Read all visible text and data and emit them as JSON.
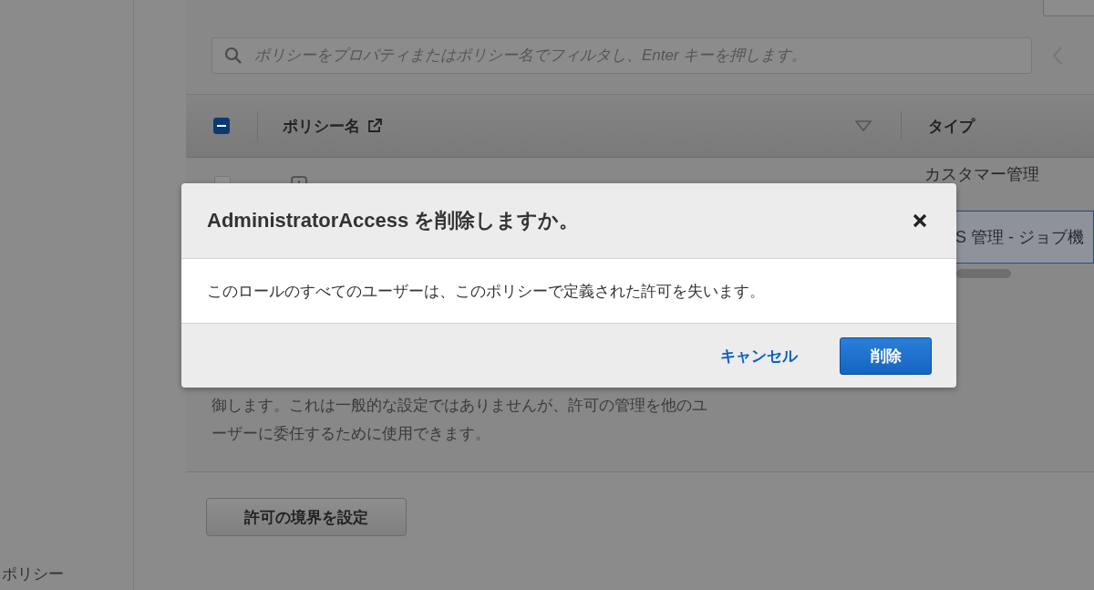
{
  "sidebar": {
    "items": [
      {
        "label": "ポリシー"
      }
    ]
  },
  "filter": {
    "placeholder": "ポリシーをプロパティまたはポリシー名でフィルタし、Enter キーを押します。"
  },
  "table": {
    "select_all": {
      "indeterminate": true
    },
    "columns": [
      {
        "label": "ポリシー名",
        "external_link": true,
        "sortable": true
      },
      {
        "label": "タイプ",
        "external_link": false,
        "sortable": false
      }
    ],
    "rows": [
      {
        "selected": false,
        "type": "カスタマー管理"
      },
      {
        "selected": true,
        "type": "S 管理 - ジョブ機"
      }
    ]
  },
  "description": {
    "lines": [
      "御します。これは一般的な設定ではありませんが、許可の管理を他のユ",
      "ーザーに委任するために使用できます。"
    ]
  },
  "boundary_button": {
    "label": "許可の境界を設定"
  },
  "dialog": {
    "title": "AdministratorAccess を削除しますか。",
    "message": "このロールのすべてのユーザーは、このポリシーで定義された許可を失います。",
    "buttons": [
      {
        "label": "キャンセル",
        "kind": "link"
      },
      {
        "label": "削除",
        "kind": "primary"
      }
    ]
  }
}
